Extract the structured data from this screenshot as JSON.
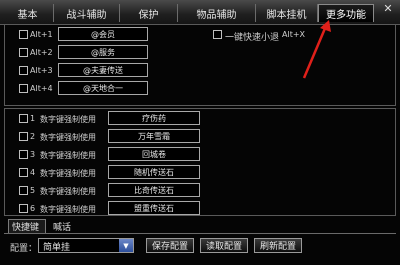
{
  "tabs": [
    {
      "label": "基本"
    },
    {
      "label": "战斗辅助"
    },
    {
      "label": "保护"
    },
    {
      "label": "物品辅助"
    },
    {
      "label": "脚本挂机"
    },
    {
      "label": "更多功能"
    }
  ],
  "close_label": "✕",
  "hotkeys": [
    {
      "key": "Alt+1",
      "value": "@会员"
    },
    {
      "key": "Alt+2",
      "value": "@服务"
    },
    {
      "key": "Alt+3",
      "value": "@夫妻传送"
    },
    {
      "key": "Alt+4",
      "value": "@天地合一"
    }
  ],
  "quick_exit": {
    "label": "一键快速小退",
    "key": "Alt+X"
  },
  "number_keys": [
    {
      "num": "1",
      "desc": "数字键强制使用",
      "item": "疗伤药"
    },
    {
      "num": "2",
      "desc": "数字键强制使用",
      "item": "万年雪霜"
    },
    {
      "num": "3",
      "desc": "数字键强制使用",
      "item": "回城卷"
    },
    {
      "num": "4",
      "desc": "数字键强制使用",
      "item": "随机传送石"
    },
    {
      "num": "5",
      "desc": "数字键强制使用",
      "item": "比奇传送石"
    },
    {
      "num": "6",
      "desc": "数字键强制使用",
      "item": "盟重传送石"
    }
  ],
  "bottom_tabs": [
    {
      "label": "快捷键"
    },
    {
      "label": "喊话"
    }
  ],
  "config": {
    "label": "配置：",
    "selected": "简单挂",
    "buttons": {
      "save": "保存配置",
      "read": "读取配置",
      "refresh": "刷新配置"
    }
  },
  "colors": {
    "accent_arrow": "#e0201a",
    "select_arrow": "#3b5ea8"
  }
}
